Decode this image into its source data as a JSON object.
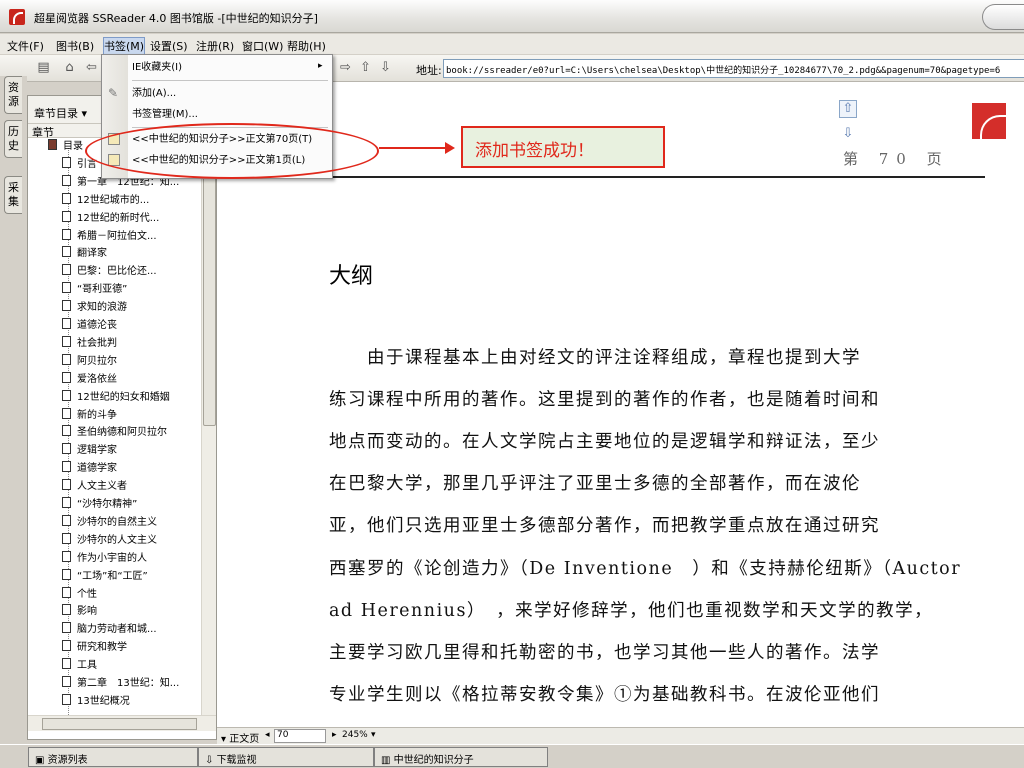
{
  "window": {
    "title": "超星阅览器 SSReader 4.0 图书馆版 -[中世纪的知识分子]"
  },
  "menubar": [
    "文件(F)",
    "图书(B)",
    "书签(M)",
    "设置(S)",
    "注册(R)",
    "窗口(W)",
    "帮助(H)"
  ],
  "toolbar": {
    "address_label": "地址:",
    "address_value": "book://ssreader/e0?url=C:\\Users\\chelsea\\Desktop\\中世纪的知识分子_10284677\\70_2.pdg&&pagenum=70&pagetype=6"
  },
  "bookmark_menu": {
    "items": [
      {
        "label": "IE收藏夹(I)",
        "has_submenu": true
      },
      {
        "label": "添加(A)..."
      },
      {
        "label": "书签管理(M)..."
      },
      {
        "label": "<<中世纪的知识分子>>正文第70页(T)"
      },
      {
        "label": "<<中世纪的知识分子>>正文第1页(L)"
      }
    ]
  },
  "vertical_tabs": [
    "资源",
    "历史",
    "采集"
  ],
  "left_panel": {
    "header": "章节目录 ▾",
    "column_header": "章节",
    "tree": [
      "目录",
      "引言",
      "第一章　12世纪：知...",
      "12世纪城市的...",
      "12世纪的新时代...",
      "希腊－阿拉伯文...",
      "翻译家",
      "巴黎：巴比伦还...",
      "“哥利亚德”",
      "求知的浪游",
      "道德沦丧",
      "社会批判",
      "阿贝拉尔",
      "爱洛依丝",
      "12世纪的妇女和婚姻",
      "新的斗争",
      "圣伯纳德和阿贝拉尔",
      "逻辑学家",
      "道德学家",
      "人文主义者",
      "“沙特尔精神”",
      "沙特尔的自然主义",
      "沙特尔的人文主义",
      "作为小宇宙的人",
      "“工场”和“工匠”",
      "个性",
      "影响",
      "脑力劳动者和城...",
      "研究和教学",
      "工具",
      "第二章　13世纪：知...",
      "13世纪概况"
    ]
  },
  "annotation": {
    "text": "添加书签成功！"
  },
  "document": {
    "page_number": "第 70 页",
    "heading": "大纲",
    "lines": [
      "　　由于课程基本上由对经文的评注诠释组成，章程也提到大学",
      "练习课程中所用的著作。这里提到的著作的作者，也是随着时间和",
      "地点而变动的。在人文学院占主要地位的是逻辑学和辩证法，至少",
      "在巴黎大学，那里几乎评注了亚里士多德的全部著作，而在波伦",
      "亚，他们只选用亚里士多德部分著作，而把教学重点放在通过研究",
      "西塞罗的《论创造力》（De Inventione　）和《支持赫伦纽斯》（Auctor",
      "ad Herennius）　，来学好修辞学，他们也重视数学和天文学的教学，",
      "主要学习欧几里得和托勒密的书，也学习其他一些人的著作。法学",
      "专业学生则以《格拉蒂安教令集》①为基础教科书。在波伦亚他们"
    ]
  },
  "statusbar": {
    "page_type": "▾ 正文页",
    "page_value": "70",
    "zoom": "245%"
  },
  "taskbar": [
    "资源列表",
    "下载监视",
    "中世纪的知识分子"
  ]
}
